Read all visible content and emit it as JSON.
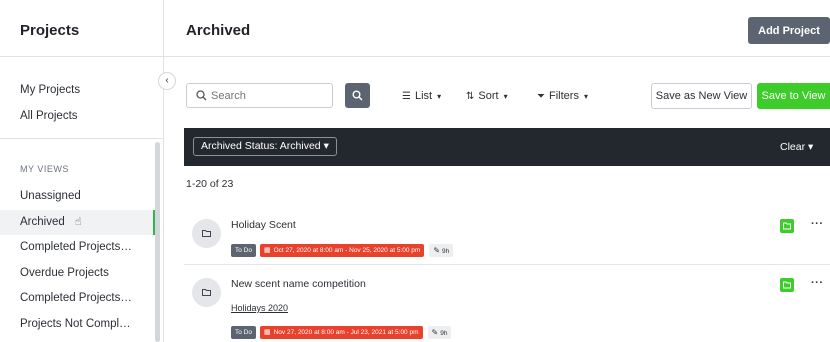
{
  "sidebar": {
    "title": "Projects",
    "top_items": [
      {
        "label": "My Projects"
      },
      {
        "label": "All Projects"
      }
    ],
    "section_label": "MY VIEWS",
    "views": [
      {
        "label": "Unassigned"
      },
      {
        "label": "Archived",
        "active": true
      },
      {
        "label": "Completed Projects - Ar..."
      },
      {
        "label": "Overdue Projects"
      },
      {
        "label": "Completed Projects - Ar..."
      },
      {
        "label": "Projects Not Completed"
      }
    ]
  },
  "header": {
    "title": "Archived",
    "add_button": "Add Project"
  },
  "toolbar": {
    "search_placeholder": "Search",
    "list_label": "List",
    "sort_label": "Sort",
    "filters_label": "Filters",
    "save_new_view": "Save as New View",
    "save_to_view": "Save to View"
  },
  "filter_bar": {
    "pill_label": "Archived Status: Archived",
    "clear_label": "Clear"
  },
  "results": {
    "count_text": "1-20 of 23"
  },
  "projects": [
    {
      "name": "Holiday Scent",
      "link": "",
      "status": "To Do",
      "dates": "Oct 27, 2020 at 8:00 am - Nov 25, 2020 at 5:00 pm",
      "hours": "9h"
    },
    {
      "name": "New scent name competition",
      "link": "Holidays 2020",
      "status": "To Do",
      "dates": "Nov 27, 2020 at 8:00 am - Jul 23, 2021 at 5:00 pm",
      "hours": "9h"
    }
  ],
  "colors": {
    "accent_green": "#3dcc2a",
    "dark_button": "#5b6470",
    "filter_bar_bg": "#23282e",
    "overdue_red": "#e8412c"
  },
  "icons": {
    "collapse": "chevron-left-icon",
    "search": "magnifier-icon",
    "list": "list-icon",
    "sort": "sort-icon",
    "filter": "filter-icon",
    "avatar": "folder-icon",
    "calendar": "calendar-icon",
    "hours": "pencil-icon",
    "more": "more-horizontal-icon"
  }
}
